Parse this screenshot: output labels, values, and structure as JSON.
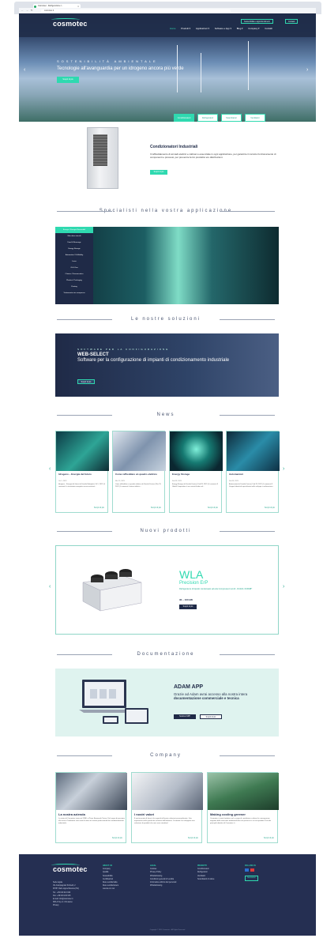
{
  "browser": {
    "tab_title": "Cosmotec - Refrigerazione I...",
    "url": "cosmotec.it"
  },
  "header": {
    "logo": "cosmotec",
    "top_buttons": [
      "Sostenibilità e approfondimenti",
      "Contatti"
    ],
    "menu": [
      "Home",
      "Prodotti ▾",
      "Applicazioni ▾",
      "Software e App ▾",
      "Blog ▾",
      "Company ▾",
      "Contatti"
    ]
  },
  "hero": {
    "kicker": "SOSTENIBILITÀ AMBIENTALE",
    "title": "Tecnologie all'avanguardia per un idrogeno ancora più verde",
    "button": "Scopri di più"
  },
  "product_tabs": [
    "Condizionatori",
    "Refrigeratori",
    "Scambiatori",
    "Ventilatori"
  ],
  "intro": {
    "title": "Condizionatori Industriali",
    "text": "Il raffreddamento di armadi elettrici e cabinet è essenziale in ogni applicazione, per garantire il corretto funzionamento di componenti e processi, per prevenire fermi produttivi e/o distribuzioni.",
    "button": "Scopri di più"
  },
  "applications": {
    "heading": "Specialisti nella vostra applicazione",
    "items": [
      "Energie / Energie Rinnovabili",
      "Macchine utensili",
      "Food & Beverage",
      "Energy Storage",
      "Automotive / E-Mobility",
      "Laser",
      "Oil & Gas",
      "Chimico / Farmaceutico",
      "Plastica / Packaging",
      "Printing",
      "Trattamento aria compressa"
    ]
  },
  "solutions": {
    "heading": "Le nostre soluzioni",
    "kicker": "SOFTWARE PER LA CONFIGURAZIONE",
    "title": "WEB-SELECT",
    "subtitle": "Software per la configurazione di impianti di condizionamento industriale",
    "button": "Scopri di più"
  },
  "news": {
    "heading": "News",
    "items": [
      {
        "title": "Idrogeno – Energia del futuro",
        "date": "Oct 5, 2023",
        "text": "Idrogeno – Energia del futuro da Daniele Battaglini | Ott 5, 2023 | 0 commenti La transizione energetica verso emissioni...",
        "more": "Scopri di più"
      },
      {
        "title": "Come raffreddare un quadro elettrico",
        "date": "Mar 29, 2023",
        "text": "Come raffreddare un quadro elettrico da Daniele Ferrina | Mar 29, 2023 | 0 commenti I sistemi elettrici...",
        "more": "Scopri di più"
      },
      {
        "title": "Energy Storage",
        "date": "Feb 28, 2023",
        "text": "Energy Storage da Daniele Ferrina | Feb 28, 2023 | 0 commenti Il Global Cooperation è una società leader nel...",
        "more": "Scopri di più"
      },
      {
        "title": "Automazioni",
        "date": "Feb 28, 2023",
        "text": "Automazioni da Daniele Ferrina | Feb 28, 2023 | 0 commenti Il Gruppo Industriale specializzato nello sviluppo e realizzazione...",
        "more": "Scopri di più"
      }
    ]
  },
  "new_products": {
    "heading": "Nuovi prodotti",
    "name": "WLA",
    "line": "Precision ErP",
    "desc": "Refrigeratore di liquido condensato ad aria Compressori scroll - R410A / R454B*",
    "power": "30 – 100 kW",
    "button": "Scopri di più"
  },
  "documentation": {
    "heading": "Documentazione",
    "title": "ADAM APP",
    "text_plain": "Grazie ad Adam avrai accesso alla nostra intera",
    "text_bold": "documentazione commerciale e tecnica",
    "buttons": [
      "Scarica l'APP",
      "Scopri di più"
    ]
  },
  "company": {
    "heading": "Company",
    "items": [
      {
        "title": "La nostra azienda",
        "text": "La storia di Cosmotec inizia nel 1986, a Pieve Emanuele Torino. Dal segno di passione alla ricerca l'ambiente sono state la base di sistemi professionali dei condizionamento industriale.",
        "more": "Scopri di più"
      },
      {
        "title": "I nostri valori",
        "text": "Il nostro punto di forza è la capacità di fornire soluzioni personalizzate. Una esperienza nelle specifiche richieste dell'industria. Cosmotec ha sviluppato una soluzione di prodotti che non sono standard.",
        "more": "Scopri di più"
      },
      {
        "title": "Making cooling greener",
        "text": "Cosmotec è stata fondata con lo scopo di contribuire a ridurre le conseguenze negative delle emissioni ambientali oltre nel processo e ai suoi prodotti. Uno dei principali obiettivi di Cosmotec è...",
        "more": "Scopri di più"
      }
    ]
  },
  "footer": {
    "logo": "cosmotec",
    "address": [
      "Sede legale",
      "Via Campagnola Torricelli, 2",
      "67057 Vado Ligure/Savona (SV)",
      "Tel.: +39 019 213 020",
      "Fax: +39 019 213 015",
      "E-mail: info@cosmotec.it",
      "SPA.O.S.p.A. Chi siamo",
      "Privacy"
    ],
    "columns": [
      {
        "title": "ABOUT US",
        "items": [
          "Company",
          "Qualità",
          "Sostenibilità",
          "Certificazioni",
          "Rete vendita Italia",
          "Rete vendita Estero",
          "Lavora con noi"
        ]
      },
      {
        "title": "LEGAL",
        "items": [
          "Cookies",
          "Privacy Policy",
          "Whistleblowing",
          "Condizioni generali di vendita",
          "Informativa utilizzo dati personali",
          "Whistleblowing"
        ]
      },
      {
        "title": "PRODOTTI",
        "items": [
          "Condizionatori",
          "Refrigeratori",
          "Ventilatori",
          "Scambiatori di calore"
        ]
      },
      {
        "title": "FOLLOW US",
        "items": [
          "Newsletter"
        ]
      }
    ],
    "copyright": "Copyright © 2024 Cosmotec - All Rights Reserved"
  },
  "colors": {
    "accent": "#2fd9b0",
    "navy": "#1f2a47"
  }
}
